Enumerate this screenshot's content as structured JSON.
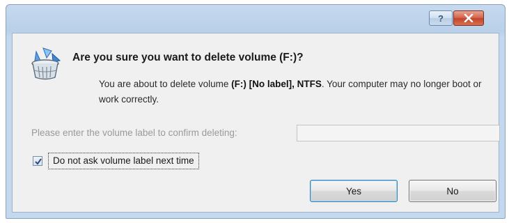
{
  "titlebar": {
    "help_icon": "help-icon",
    "help_glyph": "?",
    "close_icon": "close-icon"
  },
  "dialog": {
    "icon": "recycle-bin-icon",
    "heading": "Are you sure you want to delete volume (F:)?",
    "message": {
      "prefix": "You are about to delete volume ",
      "volume": "(F:) [No label], NTFS",
      "suffix": ". Your computer may no longer boot or work correctly."
    },
    "confirm_label": "Please enter the volume label to confirm deleting:",
    "confirm_value": "",
    "checkbox": {
      "label": "Do not ask volume label next time",
      "checked": true
    },
    "buttons": {
      "yes": "Yes",
      "no": "No"
    }
  },
  "colors": {
    "frame": "#bcd2ea",
    "client": "#f0f0f0",
    "close_button": "#c8452c",
    "disabled_text": "#9a9a9a"
  }
}
